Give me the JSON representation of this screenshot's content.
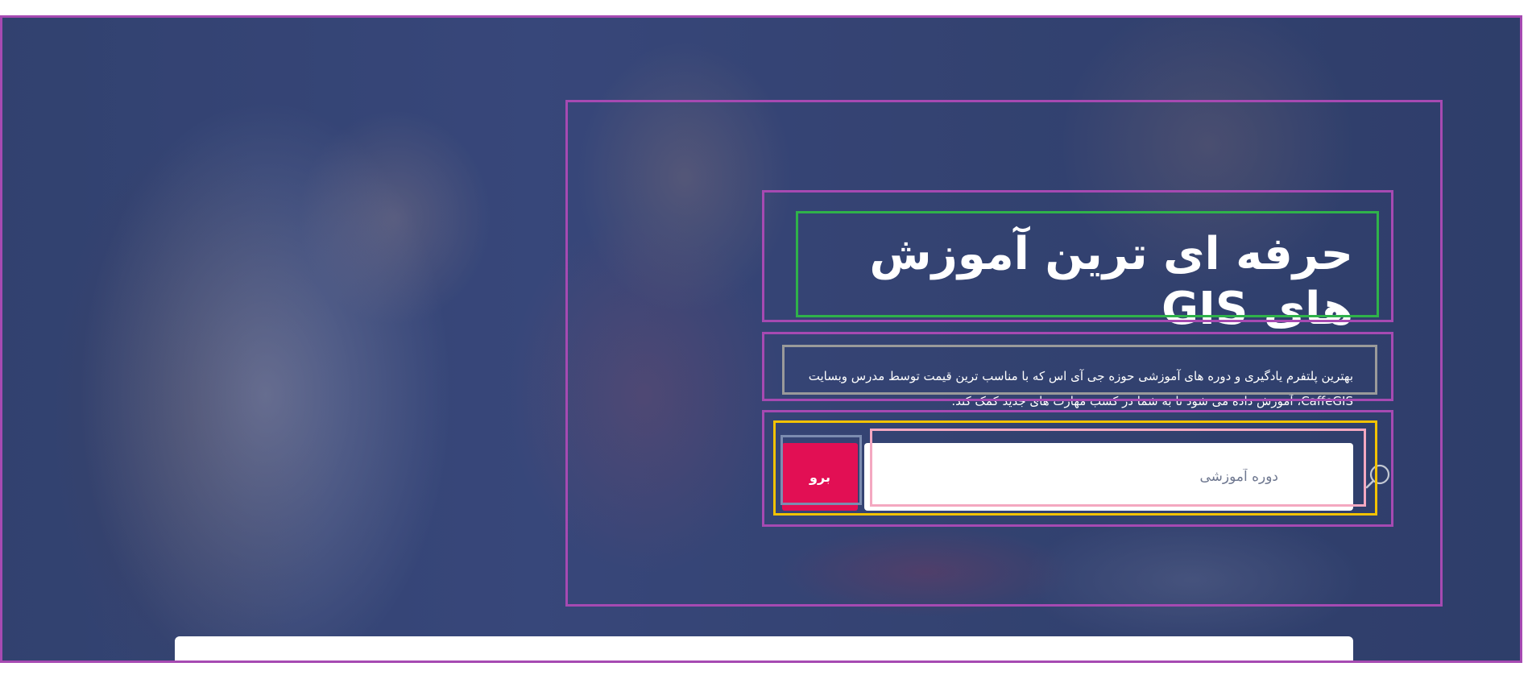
{
  "hero": {
    "heading": "حرفه ای ترین آموزش های GIS",
    "description": "بهترین پلتفرم یادگیری و دوره های آموزشی حوزه جی آی اس که با مناسب ترین قیمت توسط مدرس وبسایت CaffeGIS، آموزش داده می شود تا به شما در کسب مهارت های جدید کمک کند."
  },
  "search": {
    "placeholder": "دوره آموزشی",
    "icon": "magnifier",
    "button_label": "برو"
  },
  "colors": {
    "accent": "#e20f54",
    "overlay": "#2e3c6e",
    "text": "#ffffff"
  }
}
